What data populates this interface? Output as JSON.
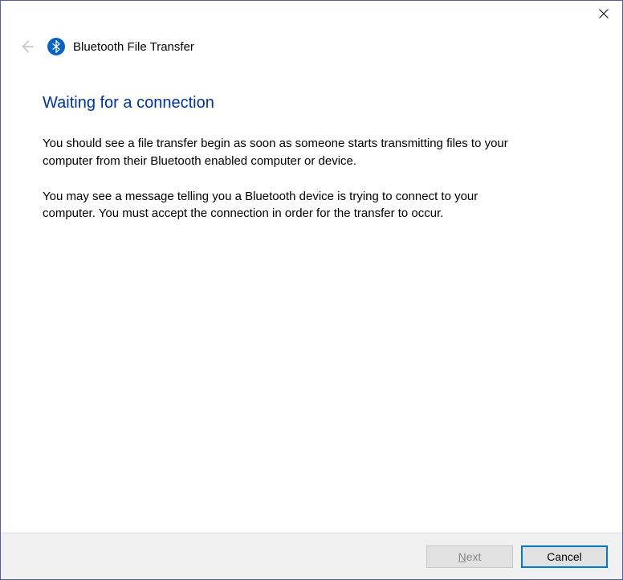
{
  "titlebar": {
    "close_aria": "Close"
  },
  "header": {
    "back_aria": "Back",
    "bt_icon_aria": "Bluetooth",
    "wizard_title": "Bluetooth File Transfer"
  },
  "content": {
    "heading": "Waiting for a connection",
    "paragraph1": "You should see a file transfer begin as soon as someone starts transmitting files to your computer from their Bluetooth enabled computer or device.",
    "paragraph2": "You may see a message telling you a Bluetooth device is trying to connect to your computer. You must accept the connection in order for the transfer to occur."
  },
  "footer": {
    "next_mnemonic": "N",
    "next_rest": "ext",
    "cancel_label": "Cancel"
  },
  "colors": {
    "accent": "#0078d7",
    "heading": "#003399",
    "bt_icon_bg": "#0a63c2"
  }
}
